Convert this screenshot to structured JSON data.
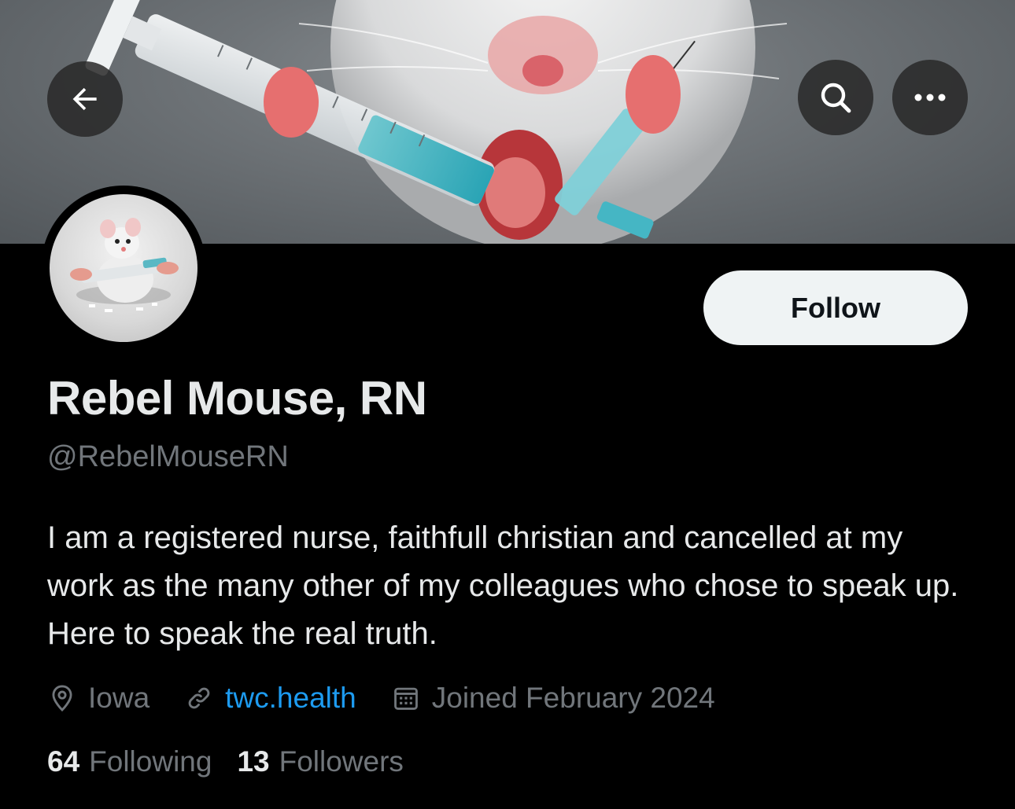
{
  "profile": {
    "display_name": "Rebel Mouse, RN",
    "handle": "@RebelMouseRN",
    "bio": "I am a registered nurse, faithfull christian and cancelled at my work as the many other of my colleagues who chose to speak up. Here to speak the real truth.",
    "location": "Iowa",
    "website": "twc.health",
    "joined": "Joined February 2024",
    "following_count": "64",
    "following_label": "Following",
    "followers_count": "13",
    "followers_label": "Followers"
  },
  "actions": {
    "follow_label": "Follow",
    "back_icon": "back-arrow-icon",
    "search_icon": "search-icon",
    "more_icon": "more-icon"
  },
  "colors": {
    "background": "#000000",
    "link": "#1d9bf0",
    "secondary_text": "#71767b",
    "primary_text": "#e7e9ea",
    "follow_button_bg": "#eff3f4"
  }
}
